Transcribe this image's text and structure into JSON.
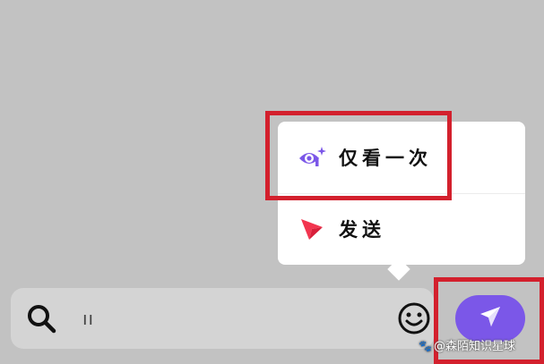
{
  "popup": {
    "items": [
      {
        "label": "仅看一次",
        "icon": "view-once-eye-icon",
        "icon_color": "#7b57e8"
      },
      {
        "label": "发送",
        "icon": "send-arrow-icon",
        "icon_color": "#f2354f"
      }
    ]
  },
  "input_bar": {
    "value": "ıı",
    "search_icon": "search-icon",
    "emoji_icon": "emoji-smiley-icon"
  },
  "send_button": {
    "icon": "send-arrow-icon",
    "color": "#7b57e8"
  },
  "highlight_color": "#d3202d",
  "watermark": {
    "text": "@森陌知识星球"
  }
}
